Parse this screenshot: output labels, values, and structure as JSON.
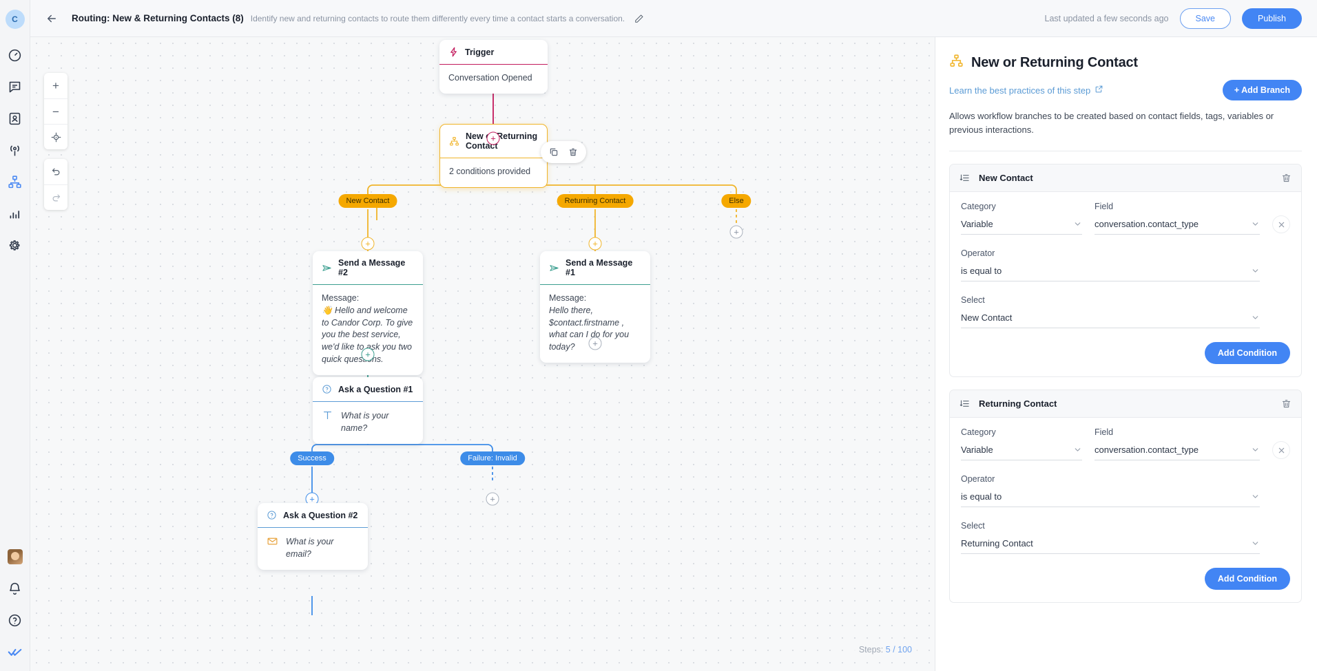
{
  "rail": {
    "logo": "C",
    "items": [
      {
        "name": "dashboard-icon",
        "label": "Dashboard"
      },
      {
        "name": "chat-icon",
        "label": "Conversations"
      },
      {
        "name": "contacts-icon",
        "label": "Contacts"
      },
      {
        "name": "broadcast-icon",
        "label": "Broadcasts"
      },
      {
        "name": "workflow-icon",
        "label": "Workflows",
        "active": true
      },
      {
        "name": "analytics-icon",
        "label": "Analytics"
      },
      {
        "name": "gear-icon",
        "label": "Settings"
      }
    ],
    "bottom": [
      {
        "name": "avatar",
        "label": "Profile"
      },
      {
        "name": "bell-icon",
        "label": "Notifications"
      },
      {
        "name": "help-icon",
        "label": "Help"
      },
      {
        "name": "checks-icon",
        "label": "Status"
      }
    ]
  },
  "topbar": {
    "back_icon": "arrow-left-icon",
    "title": "Routing: New & Returning Contacts (8)",
    "subtitle": "Identify new and returning contacts to route them differently every time a contact starts a conversation.",
    "edit_icon": "pencil-icon",
    "updated": "Last updated a few seconds ago",
    "save_label": "Save",
    "publish_label": "Publish"
  },
  "canvas": {
    "zoom_controls": [
      {
        "name": "zoom-in-button",
        "glyph": "+"
      },
      {
        "name": "zoom-out-button",
        "glyph": "−"
      },
      {
        "name": "fit-view-button",
        "glyph": "target"
      },
      {
        "name": "undo-button",
        "glyph": "undo"
      },
      {
        "name": "redo-button",
        "glyph": "redo"
      }
    ],
    "node_tools": [
      {
        "name": "duplicate-node-button",
        "icon": "copy-icon"
      },
      {
        "name": "delete-node-button",
        "icon": "trash-icon"
      }
    ],
    "steps_label": "Steps:",
    "steps_value": "5 / 100",
    "nodes": [
      {
        "id": "trigger",
        "icon": "lightning-icon",
        "title": "Trigger",
        "body": "Conversation Opened",
        "accent": "#c2185b"
      },
      {
        "id": "branch",
        "icon": "sitemap-icon",
        "title": "New or Returning Contact",
        "body": "2 conditions provided",
        "accent": "#f0b429"
      },
      {
        "id": "msg2",
        "icon": "send-icon",
        "title": "Send a Message #2",
        "body_label": "Message:",
        "body_text": "👋 Hello and welcome to Candor Corp. To give you the best service, we'd like to ask you two quick questions.",
        "accent": "#3a9e8f"
      },
      {
        "id": "msg1",
        "icon": "send-icon",
        "title": "Send a Message #1",
        "body_label": "Message:",
        "body_text": "Hello there, $contact.firstname , what can I do for you today?",
        "accent": "#3a9e8f"
      },
      {
        "id": "q1",
        "icon": "question-icon",
        "title": "Ask a Question #1",
        "field_icon": "text-input-icon",
        "body_text": "What is your name?",
        "accent": "#5b9bd5"
      },
      {
        "id": "q2",
        "icon": "question-icon",
        "title": "Ask a Question #2",
        "field_icon": "email-icon",
        "body_text": "What is your email?",
        "accent": "#5b9bd5"
      }
    ],
    "branch_pills": [
      {
        "label": "New Contact",
        "color": "amber"
      },
      {
        "label": "Returning Contact",
        "color": "amber"
      },
      {
        "label": "Else",
        "color": "amber"
      },
      {
        "label": "Success",
        "color": "blue"
      },
      {
        "label": "Failure: Invalid",
        "color": "blue"
      }
    ]
  },
  "panel": {
    "icon": "sitemap-icon",
    "title": "New or Returning Contact",
    "learn_link": "Learn the best practices of this step",
    "external_icon": "external-link-icon",
    "add_branch_label": "+ Add Branch",
    "description": "Allows workflow branches to be created based on contact fields, tags, variables or previous interactions.",
    "conditions": [
      {
        "title": "New Contact",
        "list_icon": "list-icon",
        "trash_icon": "trash-icon",
        "category_label": "Category",
        "category_value": "Variable",
        "field_label": "Field",
        "field_value": "conversation.contact_type",
        "operator_label": "Operator",
        "operator_value": "is equal to",
        "select_label": "Select",
        "select_value": "New Contact",
        "add_condition_label": "Add Condition",
        "remove_icon": "close-icon"
      },
      {
        "title": "Returning Contact",
        "list_icon": "list-icon",
        "trash_icon": "trash-icon",
        "category_label": "Category",
        "category_value": "Variable",
        "field_label": "Field",
        "field_value": "conversation.contact_type",
        "operator_label": "Operator",
        "operator_value": "is equal to",
        "select_label": "Select",
        "select_value": "Returning Contact",
        "add_condition_label": "Add Condition",
        "remove_icon": "close-icon"
      }
    ]
  },
  "colors": {
    "brand_blue": "#4285f4",
    "trigger_pink": "#c2185b",
    "branch_amber": "#f0b429",
    "message_teal": "#3a9e8f",
    "question_blue": "#5b9bd5"
  }
}
